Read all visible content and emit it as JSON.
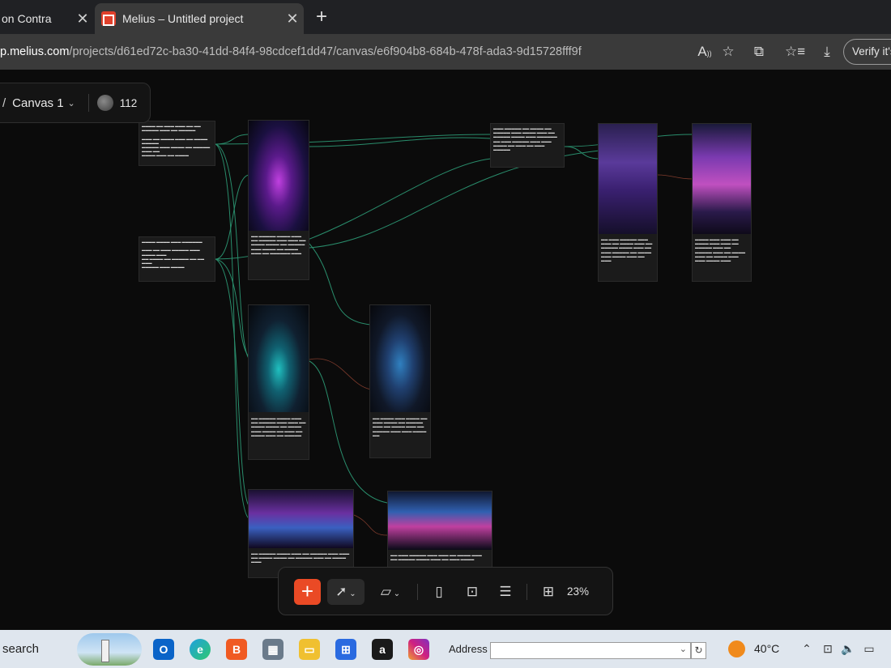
{
  "browser": {
    "tabs": [
      {
        "label": "on Contra",
        "active": false
      },
      {
        "label": "Melius – Untitled project",
        "active": true
      }
    ],
    "url_host": "p.melius.com",
    "url_path": "/projects/d61ed72c-ba30-41dd-84f4-98cdcef1dd47/canvas/e6f904b8-684b-478f-ada3-9d15728fff9f",
    "verify_label": "Verify it's"
  },
  "canvas": {
    "slash": "/",
    "name": "Canvas 1",
    "credits": "112"
  },
  "toolbar": {
    "add_label": "+",
    "zoom": "23%"
  },
  "taskbar": {
    "search": "search",
    "address_label": "Address",
    "address_value": "",
    "temperature": "40°C"
  },
  "colors": {
    "accent": "#ea4a25",
    "connector": "#2fbf8a",
    "canvas_bg": "#0b0b0b"
  }
}
